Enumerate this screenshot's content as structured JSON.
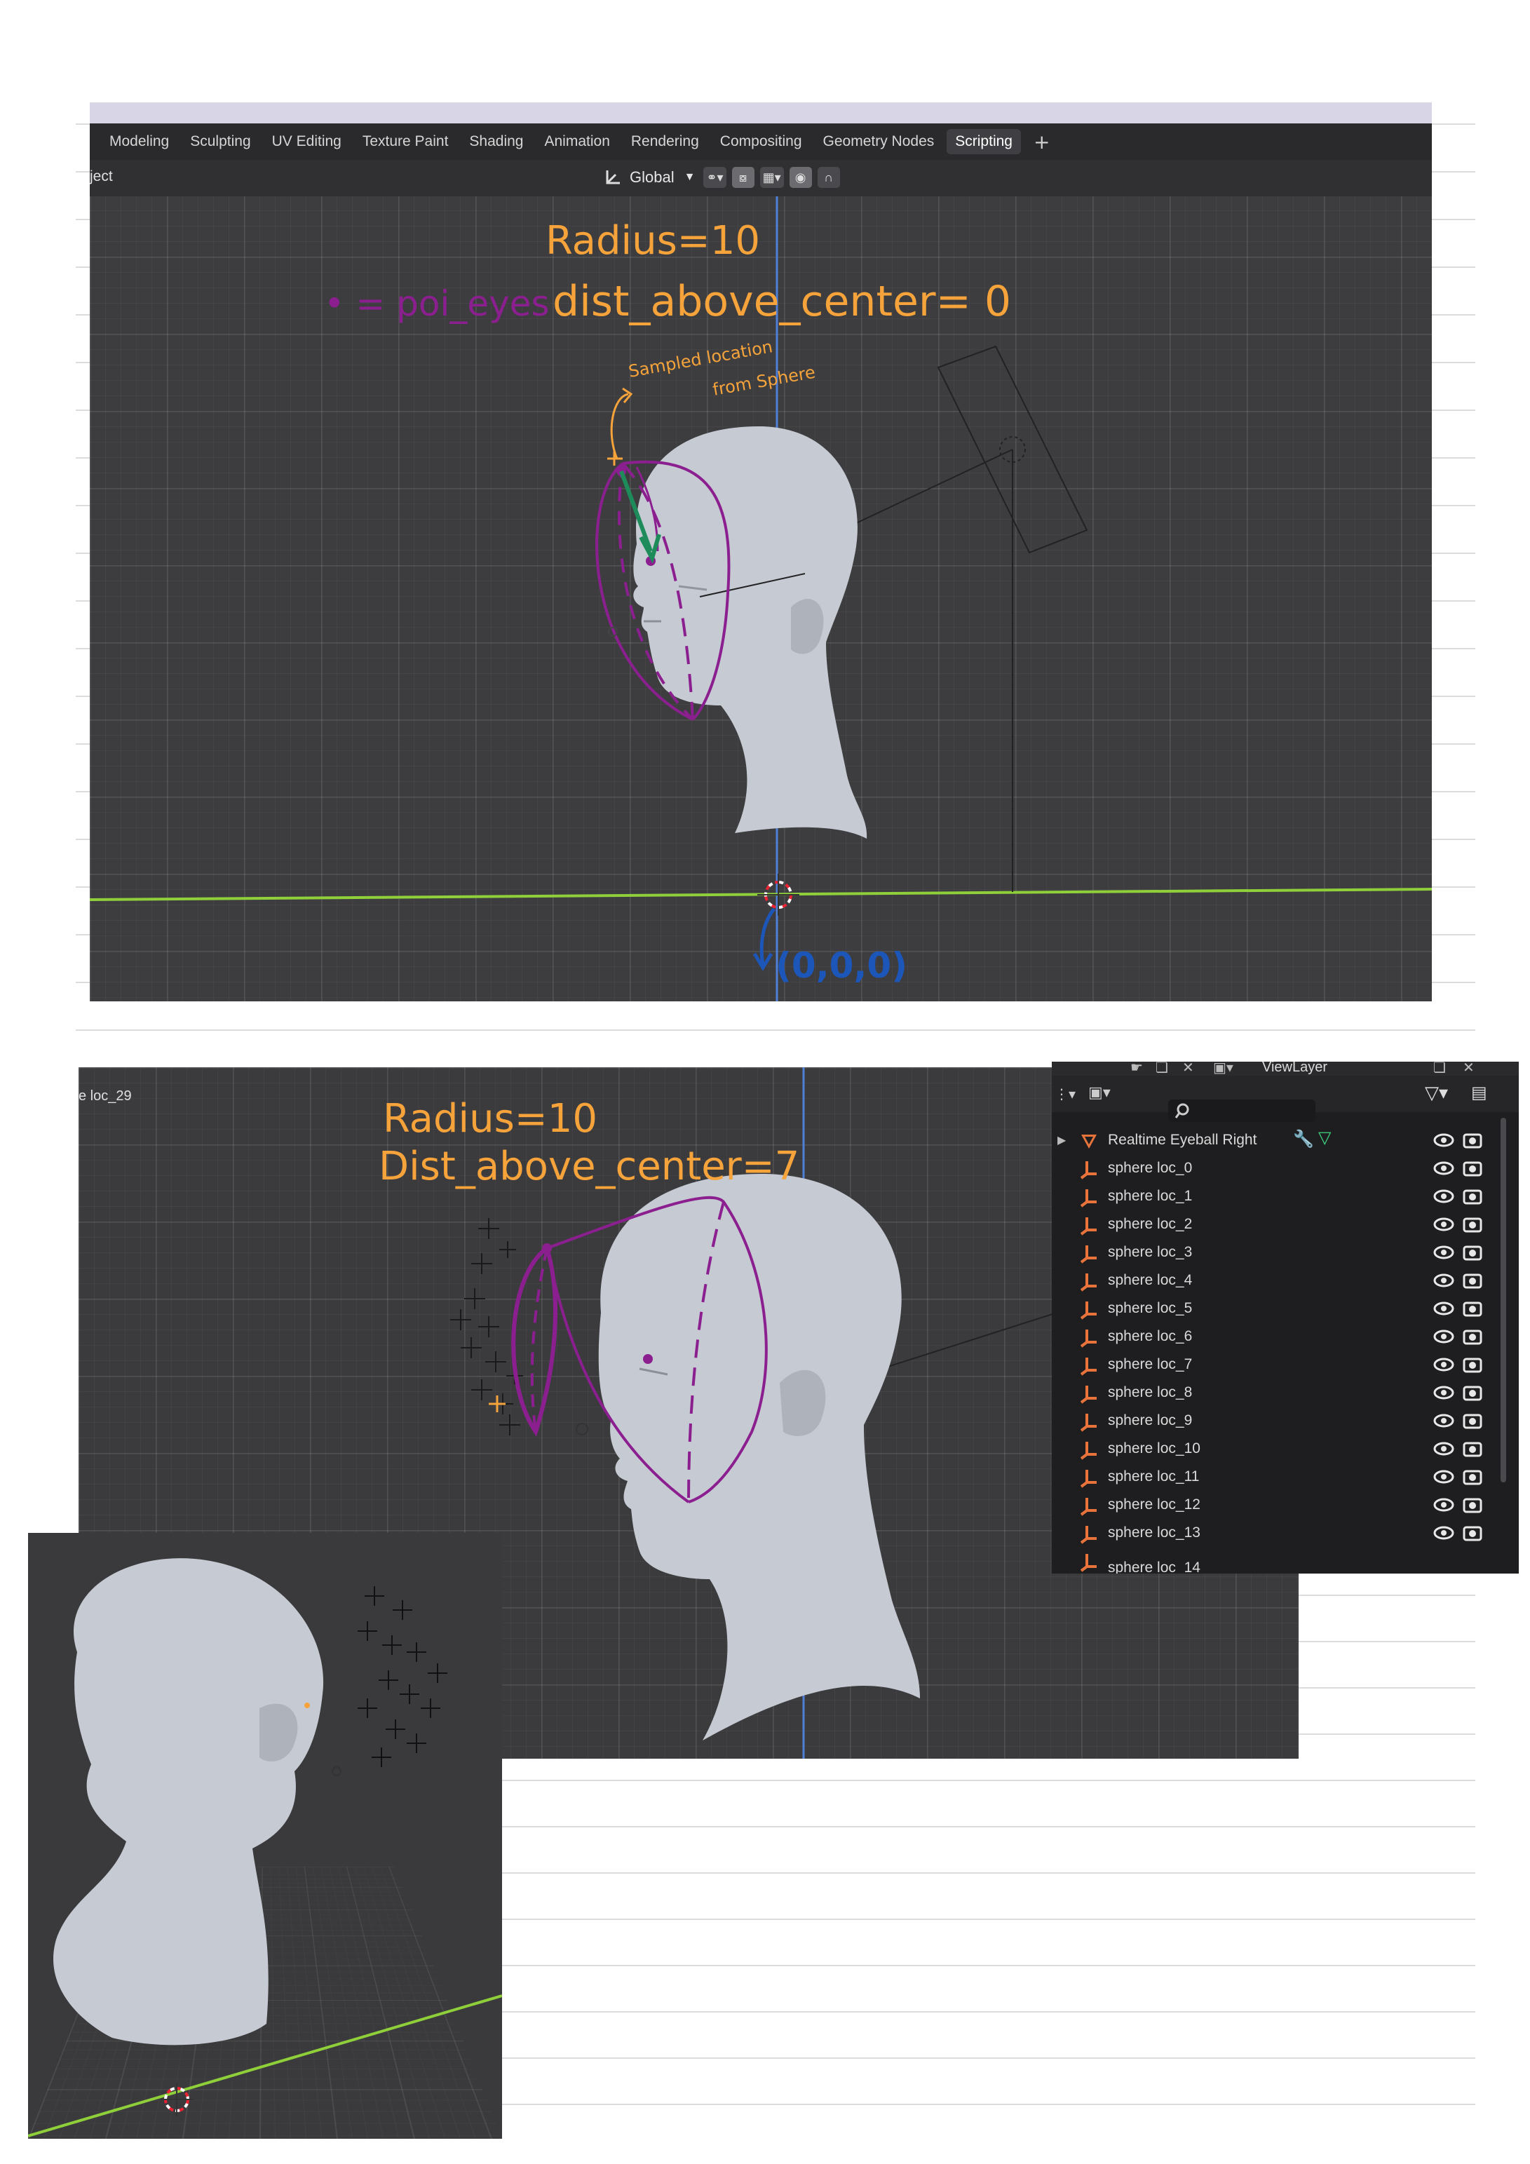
{
  "colors": {
    "annotation_orange": "#f5a33a",
    "annotation_purple": "#8c1f8f",
    "annotation_green": "#1d8c5a",
    "annotation_blue": "#1c56b8",
    "axis_green": "#8fcf3a",
    "axis_blue": "#4f7fd6",
    "viewport_bg": "#3d3d40",
    "head_gray": "#c7ccd3"
  },
  "shot1": {
    "tabs": [
      "Modeling",
      "Sculpting",
      "UV Editing",
      "Texture Paint",
      "Shading",
      "Animation",
      "Rendering",
      "Compositing",
      "Geometry Nodes",
      "Scripting"
    ],
    "active_tab": "Scripting",
    "plus": "+",
    "toolbar": {
      "object_label": "ject",
      "transform_orientation": "Global"
    },
    "annotations": {
      "radius": "Radius=10",
      "dist": "dist_above_center= 0",
      "legend": "• = poi_eyes",
      "sampled_line1": "Sampled location",
      "sampled_line2": "from Sphere",
      "origin": "(0,0,0)"
    }
  },
  "shot2": {
    "object_label": "e loc_29",
    "annotations": {
      "radius": "Radius=10",
      "dist": "Dist_above_center=7"
    }
  },
  "outliner": {
    "view_layer": "ViewLayer",
    "parent": "Realtime Eyeball Right",
    "items": [
      "sphere loc_0",
      "sphere loc_1",
      "sphere loc_2",
      "sphere loc_3",
      "sphere loc_4",
      "sphere loc_5",
      "sphere loc_6",
      "sphere loc_7",
      "sphere loc_8",
      "sphere loc_9",
      "sphere loc_10",
      "sphere loc_11",
      "sphere loc_12",
      "sphere loc_13",
      "sphere loc_14"
    ]
  },
  "icons": [
    "global-orientation-icon",
    "snap-icon",
    "proportional-edit-icon",
    "search-icon",
    "filter-icon",
    "eye-icon",
    "camera-icon",
    "empty-object-icon",
    "mesh-triangle-icon",
    "wrench-icon"
  ]
}
